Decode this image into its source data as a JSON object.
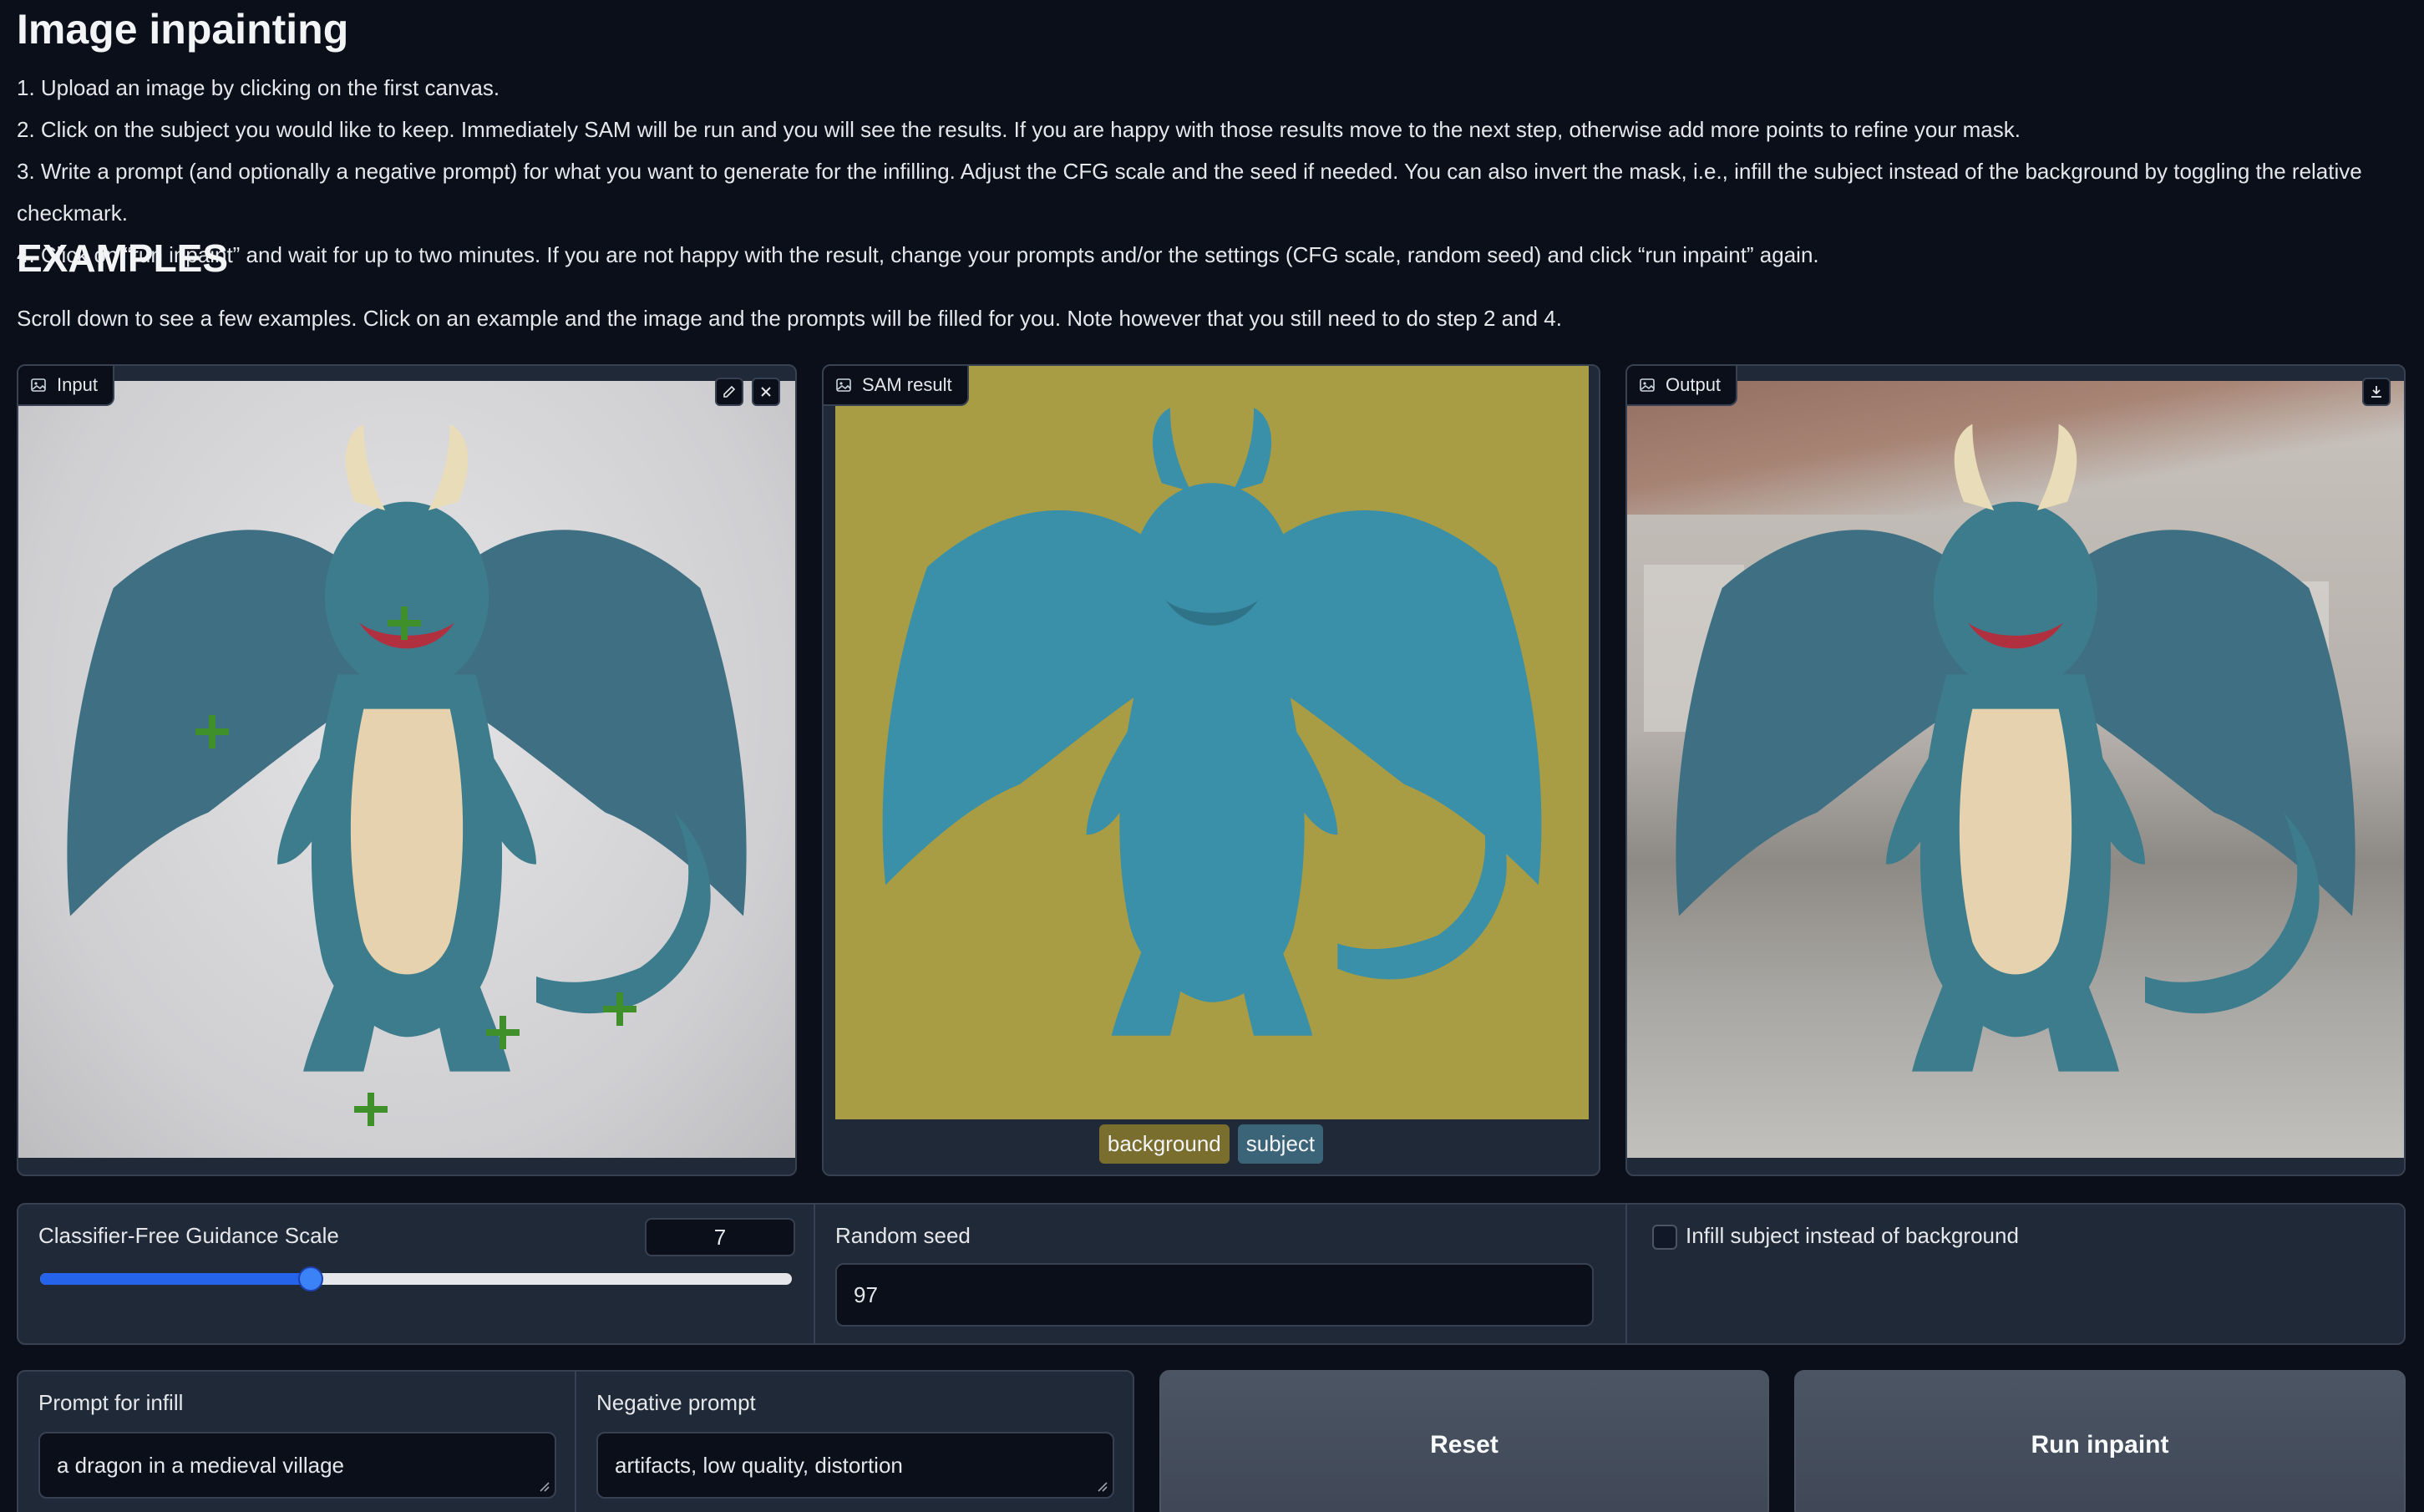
{
  "page": {
    "title": "Image inpainting",
    "steps": [
      "1. Upload an image by clicking on the first canvas.",
      "2. Click on the subject you would like to keep. Immediately SAM will be run and you will see the results. If you are happy with those results move to the next step, otherwise add more points to refine your mask.",
      "3. Write a prompt (and optionally a negative prompt) for what you want to generate for the infilling. Adjust the CFG scale and the seed if needed. You can also invert the mask, i.e., infill the subject instead of the background by toggling the relative checkmark.",
      "4. Click on “run inpaint” and wait for up to two minutes. If you are not happy with the result, change your prompts and/or the settings (CFG scale, random seed) and click “run inpaint” again."
    ],
    "examples_heading": "EXAMPLES",
    "examples_description": "Scroll down to see a few examples. Click on an example and the image and the prompts will be filled for you. Note however that you still need to do step 2 and 4."
  },
  "panels": {
    "input_label": "Input",
    "sam_label": "SAM result",
    "output_label": "Output",
    "sam_legend": [
      "background",
      "subject"
    ]
  },
  "controls": {
    "cfg_label": "Classifier-Free Guidance Scale",
    "cfg_value": "7",
    "cfg_fraction": 0.36,
    "seed_label": "Random seed",
    "seed_value": "97",
    "infill_checkbox_label": "Infill subject instead of background",
    "infill_checked": false
  },
  "prompts": {
    "infill_label": "Prompt for infill",
    "infill_value": "a dragon in a medieval village",
    "negative_label": "Negative prompt",
    "negative_value": "artifacts, low quality, distortion"
  },
  "buttons": {
    "reset": "Reset",
    "run": "Run inpaint"
  },
  "icons": [
    "image-icon",
    "edit-icon",
    "close-icon",
    "download-icon",
    "resize-handle-icon"
  ],
  "colors": {
    "background": "#0b0f19",
    "panel": "#1f2937",
    "accent": "#3b82f6",
    "dragon": "#3c7c8c",
    "sam_background": "#a89c45",
    "sam_subject": "#3a90a8",
    "point_marker": "#3f8f2a"
  }
}
